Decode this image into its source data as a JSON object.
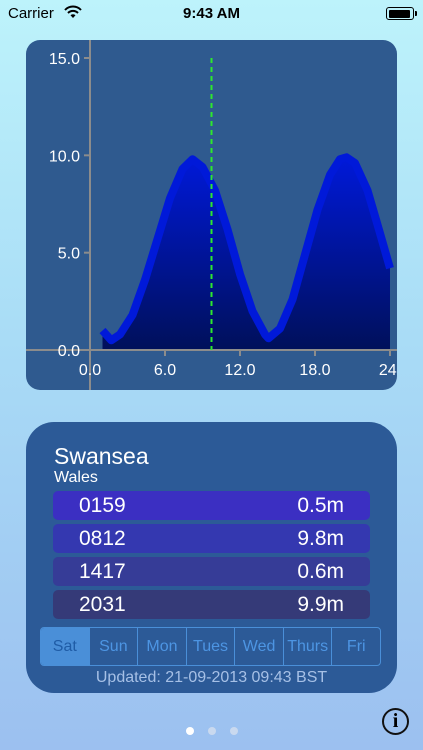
{
  "status_bar": {
    "carrier": "Carrier",
    "time": "9:43 AM",
    "battery_level": 0.95,
    "icons": [
      "wifi-icon",
      "battery-icon"
    ]
  },
  "chart_data": {
    "type": "area",
    "x_ticks": [
      "0.0",
      "6.0",
      "12.0",
      "18.0",
      "24."
    ],
    "y_ticks": [
      "0.0",
      "5.0",
      "10.0",
      "15.0"
    ],
    "xlim": [
      0,
      24
    ],
    "ylim": [
      0,
      15
    ],
    "current_time": 9.72,
    "series": [
      {
        "x": [
          1.0,
          1.7,
          2.4,
          3.4,
          4.4,
          5.4,
          6.4,
          7.4,
          8.2,
          9.0,
          10.0,
          11.0,
          12.0,
          13.0,
          14.0,
          14.28,
          15.2,
          16.2,
          17.2,
          18.2,
          19.2,
          20.0,
          20.52,
          21.2,
          22.2,
          23.2,
          24.0
        ],
        "y": [
          1.0,
          0.5,
          0.8,
          1.8,
          3.6,
          5.7,
          7.8,
          9.3,
          9.8,
          9.4,
          8.2,
          6.2,
          3.9,
          2.0,
          0.8,
          0.6,
          1.1,
          2.6,
          4.9,
          7.2,
          9.0,
          9.8,
          9.9,
          9.6,
          8.2,
          6.0,
          4.2
        ]
      }
    ],
    "colors": {
      "fill": "#0019d9",
      "fill_dark": "#00105a",
      "marker": "#2ee82e"
    }
  },
  "tides": {
    "location": "Swansea",
    "region": "Wales",
    "rows": [
      {
        "time": "0159",
        "height": "0.5m",
        "color": "#3b2fc2"
      },
      {
        "time": "0812",
        "height": "9.8m",
        "color": "#3438b0"
      },
      {
        "time": "1417",
        "height": "0.6m",
        "color": "#363c97"
      },
      {
        "time": "2031",
        "height": "9.9m",
        "color": "#353a78"
      }
    ],
    "days": [
      "Sat",
      "Sun",
      "Mon",
      "Tues",
      "Wed",
      "Thurs",
      "Fri"
    ],
    "selected_day": "Sat",
    "updated": "Updated: 21-09-2013   09:43 BST"
  },
  "pager": {
    "pages": 3,
    "current": 1
  },
  "info_button_label": "i"
}
